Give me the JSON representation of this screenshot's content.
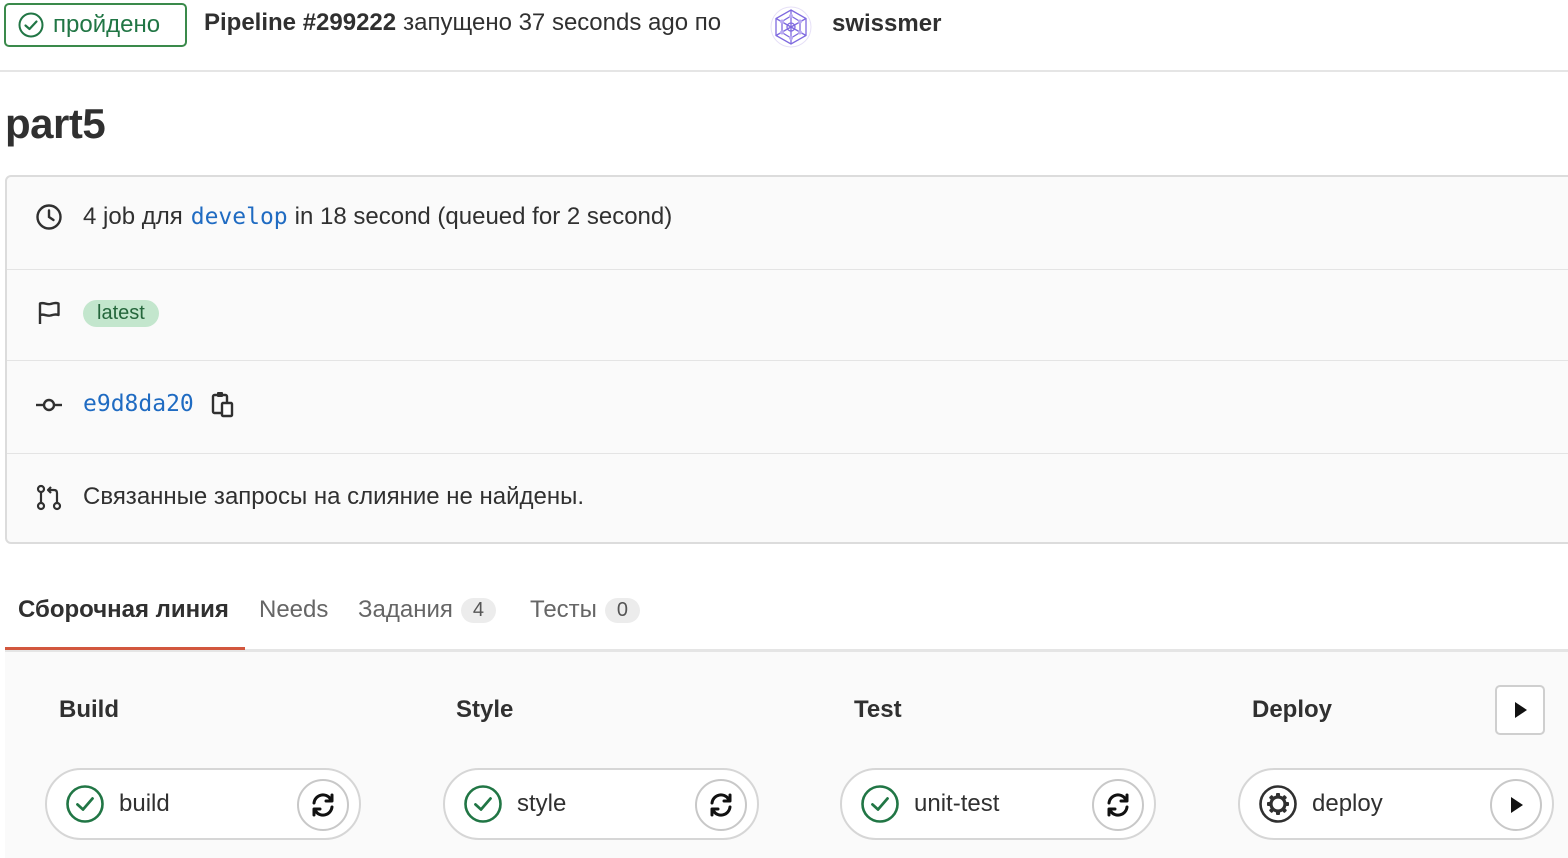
{
  "header": {
    "status": "пройдено",
    "pipeline_label": "Pipeline #299222",
    "meta": "запущено 37 seconds ago по",
    "user": "swissmer",
    "colors": {
      "success": "#217645",
      "link": "#1f6bc2",
      "tab_active": "#d2573e"
    }
  },
  "title": "part5",
  "info": {
    "jobs_prefix": "4 job для",
    "branch": "develop",
    "jobs_suffix": "in 18 second (queued for 2 second)",
    "tag": "latest",
    "commit": "e9d8da20",
    "merge_requests": "Связанные запросы на слияние не найдены."
  },
  "tabs": [
    {
      "label": "Сборочная линия"
    },
    {
      "label": "Needs"
    },
    {
      "label": "Задания",
      "count": "4"
    },
    {
      "label": "Тесты",
      "count": "0"
    }
  ],
  "stages": [
    {
      "name": "Build",
      "job": "build",
      "job_status_icon": "check-circle-icon",
      "job_action_icon": "retry-icon"
    },
    {
      "name": "Style",
      "job": "style",
      "job_status_icon": "check-circle-icon",
      "job_action_icon": "retry-icon"
    },
    {
      "name": "Test",
      "job": "unit-test",
      "job_status_icon": "check-circle-icon",
      "job_action_icon": "retry-icon"
    },
    {
      "name": "Deploy",
      "job": "deploy",
      "job_status_icon": "gear-icon",
      "job_action_icon": "play-icon"
    }
  ]
}
